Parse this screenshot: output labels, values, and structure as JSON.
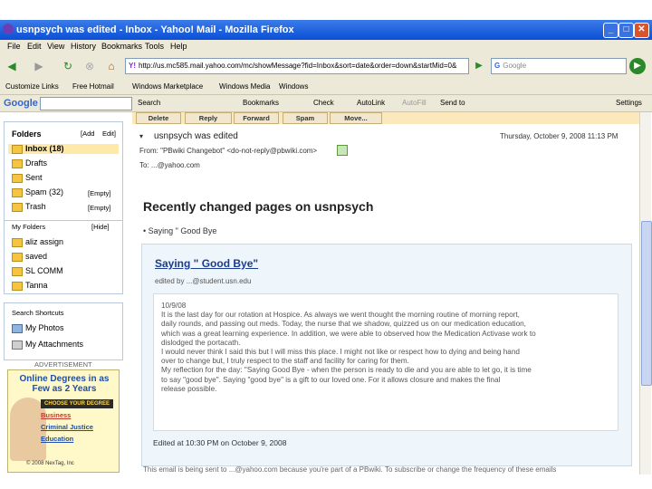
{
  "window": {
    "title": "usnpsych was edited - Inbox - Yahoo! Mail - Mozilla Firefox"
  },
  "menu": [
    "File",
    "Edit",
    "View",
    "History",
    "Bookmarks",
    "Tools",
    "Help"
  ],
  "navbar": {
    "url": "http://us.mc585.mail.yahoo.com/mc/showMessage?fid=Inbox&sort=date&order=down&startMid=0&",
    "search_placeholder": "Google"
  },
  "bookmarks": [
    "Customize Links",
    "Free Hotmail",
    "Windows Marketplace",
    "Windows Media",
    "Windows"
  ],
  "google_toolbar": {
    "brand": "Google",
    "items": [
      "Search",
      "Bookmarks",
      "Check",
      "AutoLink",
      "AutoFill",
      "Send to",
      "Settings"
    ]
  },
  "sidebar": {
    "folders_heading": "Folders",
    "folders_add": "[Add",
    "folders_edit": "Edit]",
    "folders": [
      {
        "label": "Inbox (18)"
      },
      {
        "label": "Drafts"
      },
      {
        "label": "Sent"
      },
      {
        "label": "Spam (32)",
        "action": "[Empty]"
      },
      {
        "label": "Trash",
        "action": "[Empty]"
      }
    ],
    "my_folders_heading": "My Folders",
    "my_folders_hide": "[Hide]",
    "my_folders": [
      "aliz assign",
      "saved",
      "SL COMM",
      "Tanna"
    ],
    "shortcuts_heading": "Search Shortcuts",
    "shortcuts": [
      "My Photos",
      "My Attachments"
    ],
    "ad_label": "ADVERTISEMENT",
    "ad_title": "Online Degrees in as Few as 2 Years",
    "ad_items": [
      "CHOOSE YOUR DEGREE",
      "Business",
      "Criminal Justice",
      "Education"
    ],
    "ad_footer": "© 2008 NexTag, Inc"
  },
  "actions": [
    "Delete",
    "Reply",
    "Forward",
    "Spam",
    "Move..."
  ],
  "message": {
    "subject": "usnpsych was edited",
    "date": "Thursday, October 9, 2008 11:13 PM",
    "from": "From: \"PBwiki Changebot\" <do-not-reply@pbwiki.com>",
    "to": "To: ...@yahoo.com",
    "heading": "Recently changed pages on usnpsych",
    "crumb": "Saying \" Good Bye",
    "page_title": "Saying \" Good Bye\"",
    "edited_by": "edited by ...@student.usn.edu",
    "diff_lines": [
      "10/9/08",
      "It is the last day for our rotation at Hospice. As always we went thought the morning routine of morning report,",
      "daily rounds, and passing out meds. Today, the nurse that we shadow, quizzed us on our medication education,",
      "which was a great learning experience. In addition, we were able to observed how the Medication Activase work to",
      "dislodged the portacath.",
      "I would never think I said this but I will miss this place. I might not like or respect how to dying and being hand",
      "over to change but, I truly respect to the staff and facility for caring for them.",
      "My reflection for the day: \"Saying Good Bye - when the person is ready to die and you are able to let go, it is time",
      "to say \"good bye\". Saying \"good bye\" is a gift to our loved one. For it allows closure and makes the final",
      "release possible."
    ],
    "edited_at": "Edited at 10:30 PM on October 9, 2008",
    "footer": "This email is being sent to ...@yahoo.com because you're part of a PBwiki. To subscribe or change the frequency of these emails"
  }
}
